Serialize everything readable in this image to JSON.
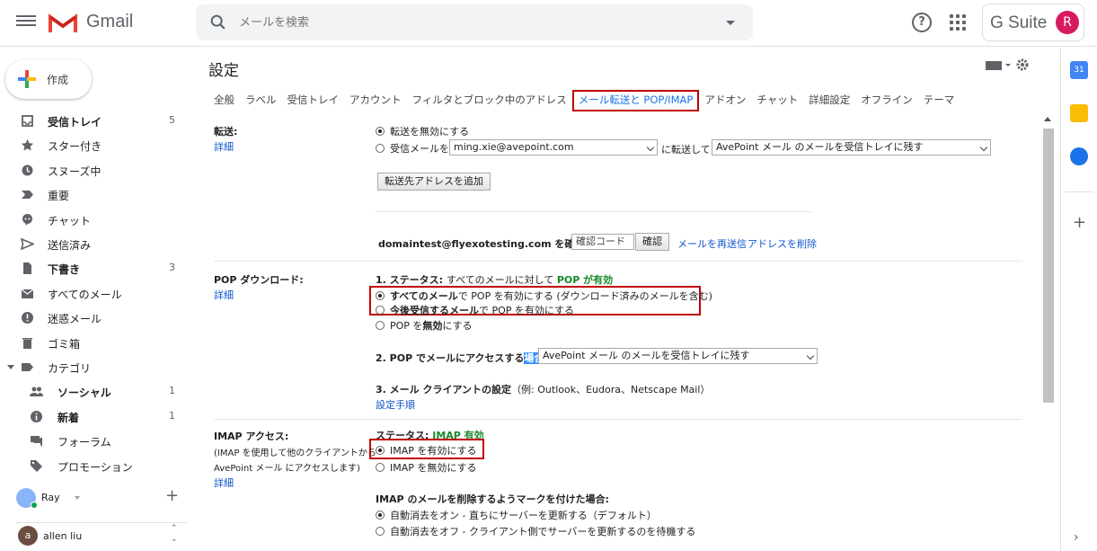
{
  "app": {
    "name": "Gmail",
    "brand_color": "#ea4335"
  },
  "search": {
    "placeholder": "メールを検索"
  },
  "header": {
    "gsuite_label": "G Suite",
    "avatar_letter": "R",
    "avatar_color": "#d81b60",
    "help_icon": "help-icon",
    "apps_icon": "apps-grid-icon"
  },
  "sidebar": {
    "compose_label": "作成",
    "items": [
      {
        "label": "受信トレイ",
        "count": "5",
        "icon": "inbox-icon",
        "bold": true
      },
      {
        "label": "スター付き",
        "count": "",
        "icon": "star-icon"
      },
      {
        "label": "スヌーズ中",
        "count": "",
        "icon": "clock-icon"
      },
      {
        "label": "重要",
        "count": "",
        "icon": "important-icon"
      },
      {
        "label": "チャット",
        "count": "",
        "icon": "chat-icon"
      },
      {
        "label": "送信済み",
        "count": "",
        "icon": "send-icon"
      },
      {
        "label": "下書き",
        "count": "3",
        "icon": "draft-icon",
        "bold": true
      },
      {
        "label": "すべてのメール",
        "count": "",
        "icon": "mail-icon"
      },
      {
        "label": "迷惑メール",
        "count": "",
        "icon": "spam-icon"
      },
      {
        "label": "ゴミ箱",
        "count": "",
        "icon": "trash-icon"
      },
      {
        "label": "カテゴリ",
        "count": "",
        "icon": "label-icon"
      },
      {
        "label": "ソーシャル",
        "count": "1",
        "icon": "people-icon",
        "bold": true
      },
      {
        "label": "新着",
        "count": "1",
        "icon": "info-icon",
        "bold": true
      },
      {
        "label": "フォーラム",
        "count": "",
        "icon": "forum-icon"
      },
      {
        "label": "プロモーション",
        "count": "",
        "icon": "tag-icon"
      }
    ],
    "hangouts_user": "Ray",
    "contact": {
      "name": "allen liu",
      "initial": "a"
    }
  },
  "settings": {
    "title": "設定",
    "tabs": [
      "全般",
      "ラベル",
      "受信トレイ",
      "アカウント",
      "フィルタとブロック中のアドレス",
      "メール転送と POP/IMAP",
      "アドオン",
      "チャット",
      "詳細設定",
      "オフライン",
      "テーマ"
    ],
    "active_tab": "メール転送と POP/IMAP",
    "forwarding": {
      "label": "転送:",
      "detail_link": "詳細",
      "opt_disable": "転送を無効にする",
      "opt_forward_prefix": "受信メールを",
      "forward_address": "ming.xie@avepoint.com",
      "forward_mid": "に転送して",
      "forward_action": "AvePoint メール のメールを受信トレイに残す",
      "add_button": "転送先アドレスを追加",
      "verify_address": "domaintest@flyexotesting.com を確認",
      "verify_placeholder": "確認コード",
      "verify_button": "確認",
      "resend_link": "メールを再送信",
      "delete_link": "アドレスを削除"
    },
    "pop": {
      "label": "POP ダウンロード:",
      "detail_link": "詳細",
      "status_prefix": "1. ステータス: ",
      "status_text": "すべてのメールに対して ",
      "status_value": "POP が有効",
      "opt_all_bold": "すべてのメール",
      "opt_all_rest": "で POP を有効にする (ダウンロード済みのメールを含む)",
      "opt_new_bold": "今後受信するメール",
      "opt_new_rest": "で POP を有効にする",
      "opt_disable_pre": "POP を",
      "opt_disable_bold": "無効",
      "opt_disable_post": "にする",
      "access_prefix": "2. POP でメールにアクセスする",
      "access_hl": "場合",
      "access_action": "AvePoint メール のメールを受信トレイに残す",
      "client_title": "3. メール クライアントの設定",
      "client_examples": "（例: Outlook、Eudora、Netscape Mail）",
      "setup_link": "設定手順"
    },
    "imap": {
      "label": "IMAP アクセス:",
      "note1": "(IMAP を使用して他のクライアントから",
      "note2": "AvePoint メール にアクセスします)",
      "detail_link": "詳細",
      "status_prefix": "ステータス: ",
      "status_value": "IMAP 有効",
      "opt_enable": "IMAP を有効にする",
      "opt_disable": "IMAP を無効にする",
      "delete_title": "IMAP のメールを削除するようマークを付けた場合:",
      "opt_auto_on": "自動消去をオン - 直ちにサーバーを更新する（デフォルト）",
      "opt_auto_off": "自動消去をオフ - クライアント側でサーバーを更新するのを待機する"
    }
  }
}
